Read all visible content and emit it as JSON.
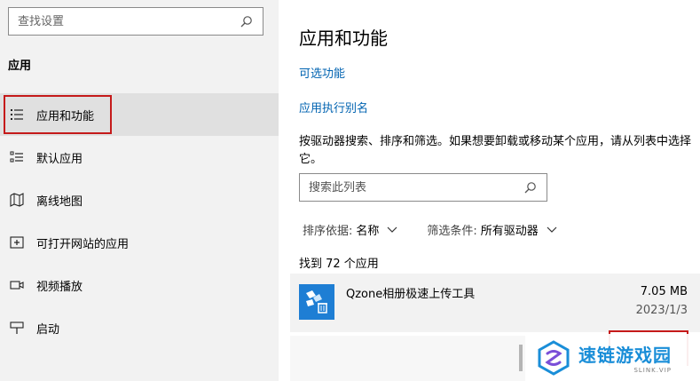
{
  "sidebar": {
    "search_placeholder": "查找设置",
    "section_title": "应用",
    "items": [
      {
        "label": "应用和功能",
        "icon": "apps-features-icon"
      },
      {
        "label": "默认应用",
        "icon": "default-apps-icon"
      },
      {
        "label": "离线地图",
        "icon": "offline-maps-icon"
      },
      {
        "label": "可打开网站的应用",
        "icon": "apps-for-websites-icon"
      },
      {
        "label": "视频播放",
        "icon": "video-playback-icon"
      },
      {
        "label": "启动",
        "icon": "startup-icon"
      }
    ]
  },
  "main": {
    "title": "应用和功能",
    "link_optional_features": "可选功能",
    "link_app_aliases": "应用执行别名",
    "description": "按驱动器搜索、排序和筛选。如果想要卸载或移动某个应用，请从列表中选择它。",
    "search_placeholder": "搜索此列表",
    "sort_label": "排序依据:",
    "sort_value": "名称",
    "filter_label": "筛选条件:",
    "filter_value": "所有驱动器",
    "count_text": "找到 72 个应用",
    "apps": [
      {
        "name": "Qzone相册极速上传工具",
        "size": "7.05 MB",
        "date": "2023/1/3"
      }
    ]
  },
  "watermark": {
    "text": "速链游戏园",
    "sub": "SLINK.VIP"
  },
  "colors": {
    "link": "#0063b1",
    "highlight_border": "#c51a1a",
    "app_icon_bg": "#1e7ed4",
    "watermark": "#1a8ed8"
  }
}
